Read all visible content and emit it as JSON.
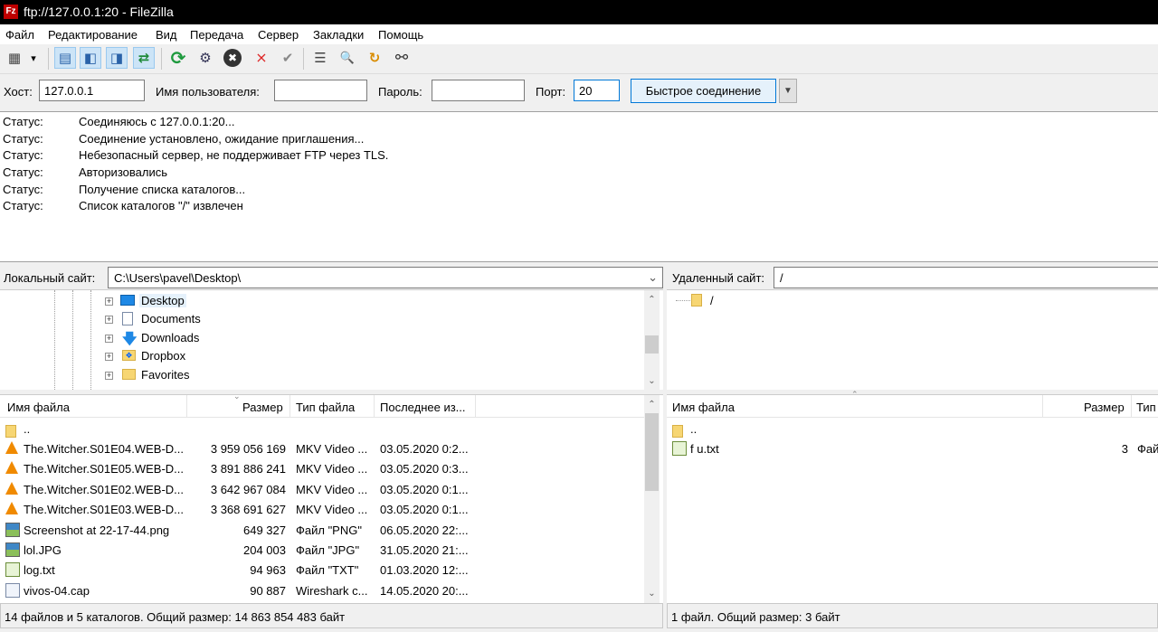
{
  "window": {
    "title": "ftp://127.0.0.1:20 - FileZilla",
    "app_icon": "Fz"
  },
  "menu": [
    "Файл",
    "Редактирование",
    "Вид",
    "Передача",
    "Сервер",
    "Закладки",
    "Помощь"
  ],
  "toolbar": [
    {
      "name": "site-manager-icon",
      "glyph": "▦"
    },
    {
      "name": "dropdown-arrow-icon",
      "glyph": "▾"
    },
    {
      "name": "toggle-message-log-icon",
      "glyph": "▤",
      "active": true
    },
    {
      "name": "toggle-local-tree-icon",
      "glyph": "◧",
      "active": true
    },
    {
      "name": "toggle-remote-tree-icon",
      "glyph": "◨",
      "active": true
    },
    {
      "name": "toggle-transfer-queue-icon",
      "glyph": "⇄",
      "active": true
    },
    {
      "name": "refresh-icon",
      "glyph": "⟳"
    },
    {
      "name": "process-queue-icon",
      "glyph": "⚙"
    },
    {
      "name": "cancel-operation-icon",
      "glyph": "✖"
    },
    {
      "name": "disconnect-icon",
      "glyph": "⨯"
    },
    {
      "name": "reconnect-icon",
      "glyph": "✔"
    },
    {
      "name": "filter-icon",
      "glyph": "☰"
    },
    {
      "name": "search-icon",
      "glyph": "🔍"
    },
    {
      "name": "sync-browse-icon",
      "glyph": "↻"
    },
    {
      "name": "binoculars-icon",
      "glyph": "⚯"
    }
  ],
  "quickconnect": {
    "host_label": "Хост:",
    "host_value": "127.0.0.1",
    "user_label": "Имя пользователя:",
    "user_value": "",
    "pass_label": "Пароль:",
    "pass_value": "",
    "port_label": "Порт:",
    "port_value": "20",
    "connect_label": "Быстрое соединение"
  },
  "log": [
    {
      "k": "Статус:",
      "v": "Соединяюсь с 127.0.0.1:20..."
    },
    {
      "k": "Статус:",
      "v": "Соединение установлено, ожидание приглашения..."
    },
    {
      "k": "Статус:",
      "v": "Небезопасный сервер, не поддерживает FTP через TLS."
    },
    {
      "k": "Статус:",
      "v": "Авторизовались"
    },
    {
      "k": "Статус:",
      "v": "Получение списка каталогов..."
    },
    {
      "k": "Статус:",
      "v": "Список каталогов \"/\" извлечен"
    }
  ],
  "local": {
    "site_label": "Локальный сайт:",
    "path": "C:\\Users\\pavel\\Desktop\\",
    "tree": [
      {
        "label": "Desktop",
        "icon": "desktop-folder-icon",
        "selected": true
      },
      {
        "label": "Documents",
        "icon": "documents-icon"
      },
      {
        "label": "Downloads",
        "icon": "downloads-icon"
      },
      {
        "label": "Dropbox",
        "icon": "dropbox-icon"
      },
      {
        "label": "Favorites",
        "icon": "favorites-icon"
      }
    ],
    "columns": [
      "Имя файла",
      "Размер",
      "Тип файла",
      "Последнее из..."
    ],
    "files": [
      {
        "name": "..",
        "size": "",
        "type": "",
        "date": "",
        "icon": "parent-folder-icon"
      },
      {
        "name": "The.Witcher.S01E04.WEB-D...",
        "size": "3 959 056 169",
        "type": "MKV Video ...",
        "date": "03.05.2020 0:2...",
        "icon": "vlc-icon"
      },
      {
        "name": "The.Witcher.S01E05.WEB-D...",
        "size": "3 891 886 241",
        "type": "MKV Video ...",
        "date": "03.05.2020 0:3...",
        "icon": "vlc-icon"
      },
      {
        "name": "The.Witcher.S01E02.WEB-D...",
        "size": "3 642 967 084",
        "type": "MKV Video ...",
        "date": "03.05.2020 0:1...",
        "icon": "vlc-icon"
      },
      {
        "name": "The.Witcher.S01E03.WEB-D...",
        "size": "3 368 691 627",
        "type": "MKV Video ...",
        "date": "03.05.2020 0:1...",
        "icon": "vlc-icon"
      },
      {
        "name": "Screenshot at 22-17-44.png",
        "size": "649 327",
        "type": "Файл \"PNG\"",
        "date": "06.05.2020 22:...",
        "icon": "image-icon"
      },
      {
        "name": "lol.JPG",
        "size": "204 003",
        "type": "Файл \"JPG\"",
        "date": "31.05.2020 21:...",
        "icon": "image-icon"
      },
      {
        "name": "log.txt",
        "size": "94 963",
        "type": "Файл \"TXT\"",
        "date": "01.03.2020 12:...",
        "icon": "text-file-icon"
      },
      {
        "name": "vivos-04.cap",
        "size": "90 887",
        "type": "Wireshark c...",
        "date": "14.05.2020 20:...",
        "icon": "capture-file-icon"
      }
    ],
    "status": "14 файлов и 5 каталогов. Общий размер: 14 863 854 483 байт"
  },
  "remote": {
    "site_label": "Удаленный сайт:",
    "path": "/",
    "tree_root": "/",
    "columns": [
      "Имя файла",
      "Размер",
      "Тип"
    ],
    "files": [
      {
        "name": "..",
        "size": "",
        "type": "",
        "icon": "parent-folder-icon"
      },
      {
        "name": "f u.txt",
        "size": "3",
        "type": "Фай",
        "icon": "text-file-icon"
      }
    ],
    "status": "1 файл. Общий размер: 3 байт"
  }
}
